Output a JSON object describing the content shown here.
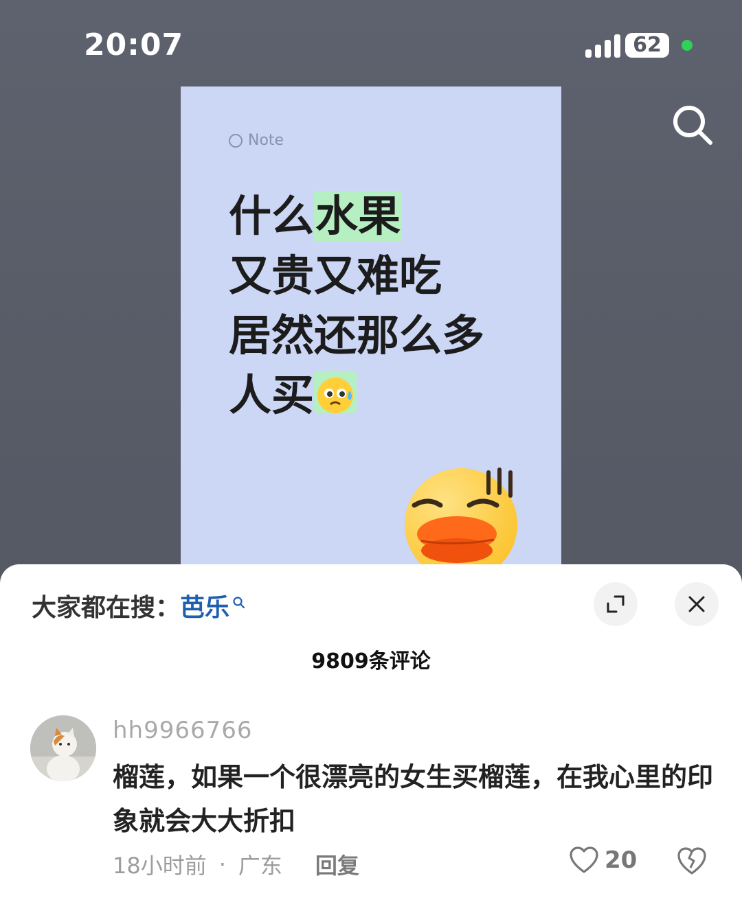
{
  "status_bar": {
    "time": "20:07",
    "battery": "62"
  },
  "note_card": {
    "label": "Note",
    "title_line1_plain": "什么",
    "title_line1_highlight": "水果",
    "title_line2": "又贵又难吃",
    "title_line3": "居然还那么多",
    "title_line4": "人买"
  },
  "sheet": {
    "hot_search_prefix": "大家都在搜：",
    "hot_search_keyword": "芭乐",
    "comment_count": "9809条评论"
  },
  "comment": {
    "username": "hh9966766",
    "text": "榴莲，如果一个很漂亮的女生买榴莲，在我心里的印象就会大大折扣",
    "time": "18小时前",
    "separator": "·",
    "location": "广东",
    "reply_label": "回复",
    "like_count": "20"
  },
  "colors": {
    "accent_keyword": "#1f5fb0",
    "highlight": "#b6f0c2",
    "card_bg": "#ccd6f5"
  }
}
